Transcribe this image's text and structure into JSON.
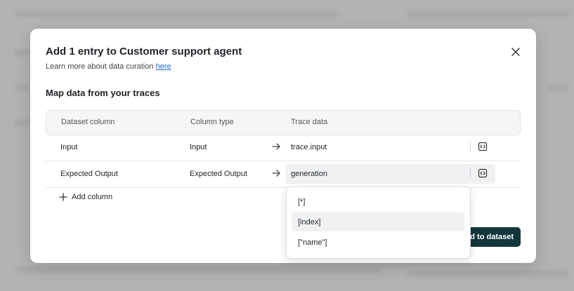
{
  "modal": {
    "title": "Add 1 entry to Customer support agent",
    "subtitle_prefix": "Learn more about data curation",
    "subtitle_link": "here",
    "section_title": "Map data from your traces",
    "headers": {
      "dataset_column": "Dataset column",
      "column_type": "Column type",
      "trace_data": "Trace data"
    },
    "rows": [
      {
        "column": "Input",
        "type": "Input",
        "trace": "trace.input"
      },
      {
        "column": "Expected Output",
        "type": "Expected Output",
        "trace": "generation"
      }
    ],
    "add_column_label": "Add column",
    "submit_label": "d to dataset"
  },
  "dropdown": {
    "options": [
      "[*]",
      "[index]",
      "[\"name\"]"
    ],
    "highlighted_index": 1
  },
  "colors": {
    "primary_button": "#12363b",
    "link": "#1f6fd1",
    "highlight": "#f0f1f3"
  }
}
